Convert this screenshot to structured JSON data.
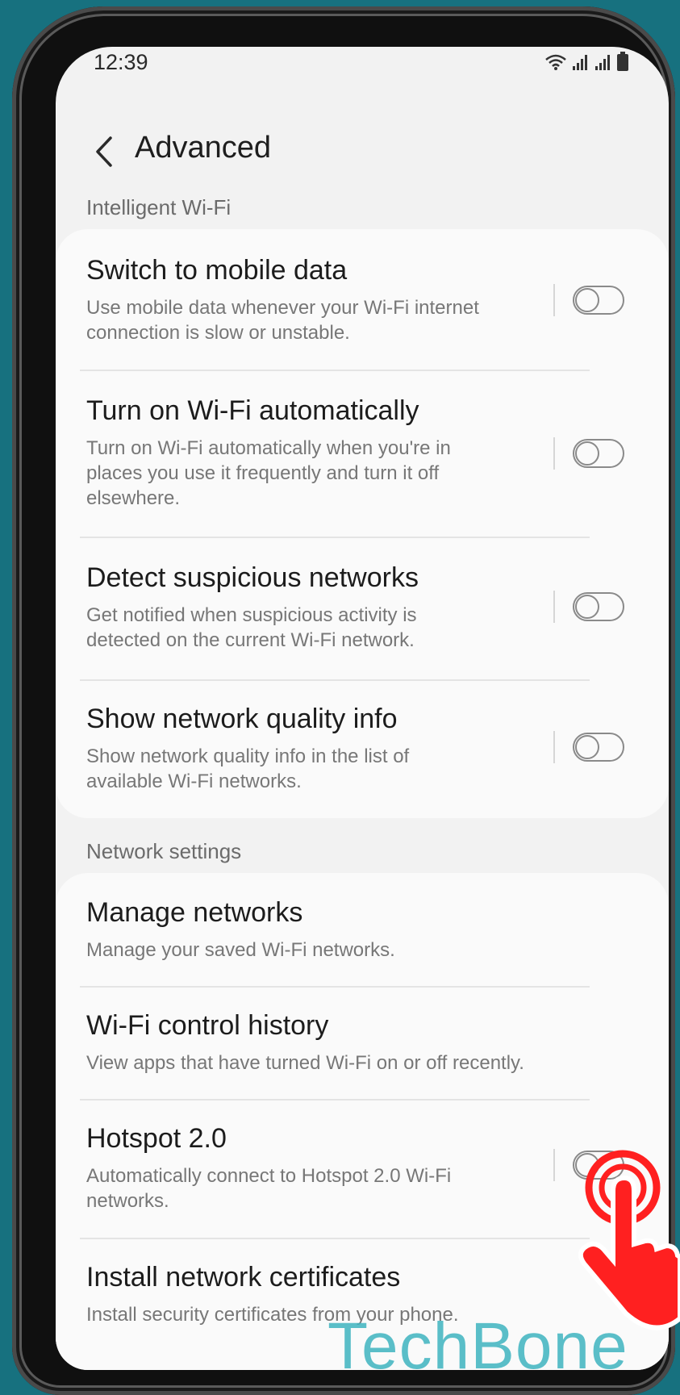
{
  "status_bar": {
    "time": "12:39",
    "icons": [
      "wifi-icon",
      "signal-icon",
      "signal-icon",
      "battery-icon"
    ]
  },
  "header": {
    "back_icon": "chevron-left-icon",
    "title": "Advanced"
  },
  "sections": [
    {
      "title": "Intelligent Wi-Fi",
      "items": [
        {
          "title": "Switch to mobile data",
          "subtitle": "Use mobile data whenever your Wi-Fi internet connection is slow or unstable.",
          "toggle": "off"
        },
        {
          "title": "Turn on Wi-Fi automatically",
          "subtitle": "Turn on Wi-Fi automatically when you're in places you use it frequently and turn it off elsewhere.",
          "toggle": "off"
        },
        {
          "title": "Detect suspicious networks",
          "subtitle": "Get notified when suspicious activity is detected on the current Wi-Fi network.",
          "toggle": "off"
        },
        {
          "title": "Show network quality info",
          "subtitle": "Show network quality info in the list of available Wi-Fi networks.",
          "toggle": "off"
        }
      ]
    },
    {
      "title": "Network settings",
      "items": [
        {
          "title": "Manage networks",
          "subtitle": "Manage your saved Wi-Fi networks."
        },
        {
          "title": "Wi-Fi control history",
          "subtitle": "View apps that have turned Wi-Fi on or off recently."
        },
        {
          "title": "Hotspot 2.0",
          "subtitle": "Automatically connect to Hotspot 2.0 Wi-Fi networks.",
          "toggle": "off"
        },
        {
          "title": "Install network certificates",
          "subtitle": "Install security certificates from your phone."
        }
      ]
    }
  ],
  "watermark": "TechBone",
  "colors": {
    "background": "#17717f",
    "screen": "#f2f2f2",
    "card": "#fafafa",
    "watermark": "#3fb4c0",
    "tap_hand": "#ff2020"
  },
  "overlay": {
    "tap_icon": "tap-hand-icon"
  }
}
